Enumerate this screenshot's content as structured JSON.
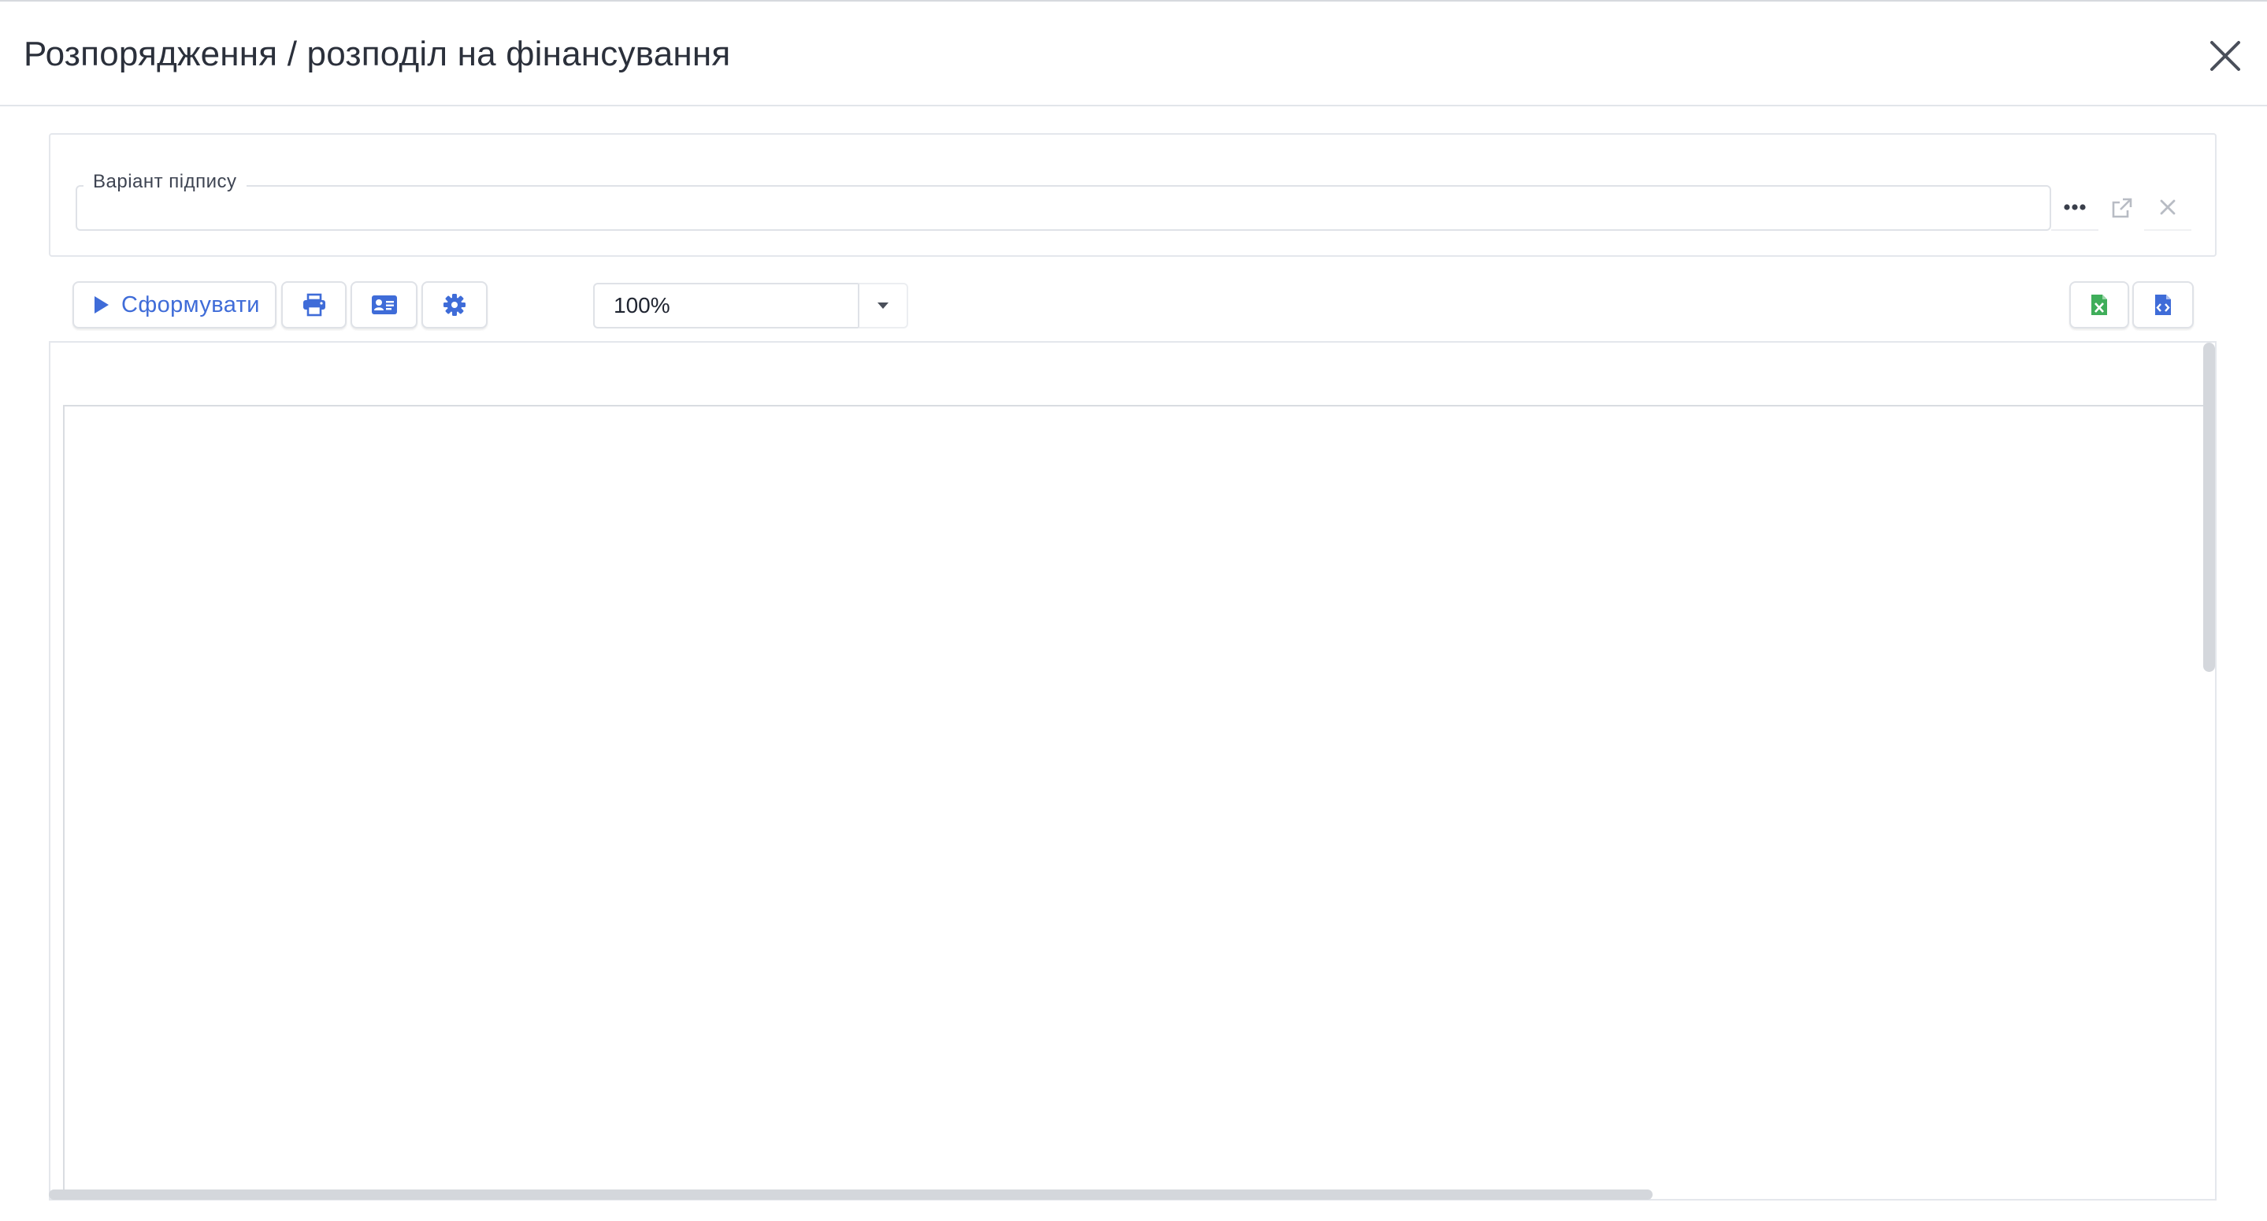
{
  "header": {
    "title": "Розпорядження / розподіл на фінансування",
    "close_icon": "close-icon"
  },
  "signature": {
    "label": "Варіант підпису",
    "value": "",
    "buttons": [
      "more-icon",
      "open-external-icon",
      "clear-icon"
    ]
  },
  "toolbar": {
    "form_label": "Сформувати",
    "zoom_value": "100%",
    "icons": [
      "play-icon",
      "print-icon",
      "id-card-icon",
      "gear-icon",
      "excel-file-icon",
      "code-file-icon"
    ]
  },
  "colors": {
    "accent": "#3f6cd8",
    "excel": "#3fae5a",
    "border": "#dfe2e7",
    "scrollbar": "#d4d7dc"
  }
}
